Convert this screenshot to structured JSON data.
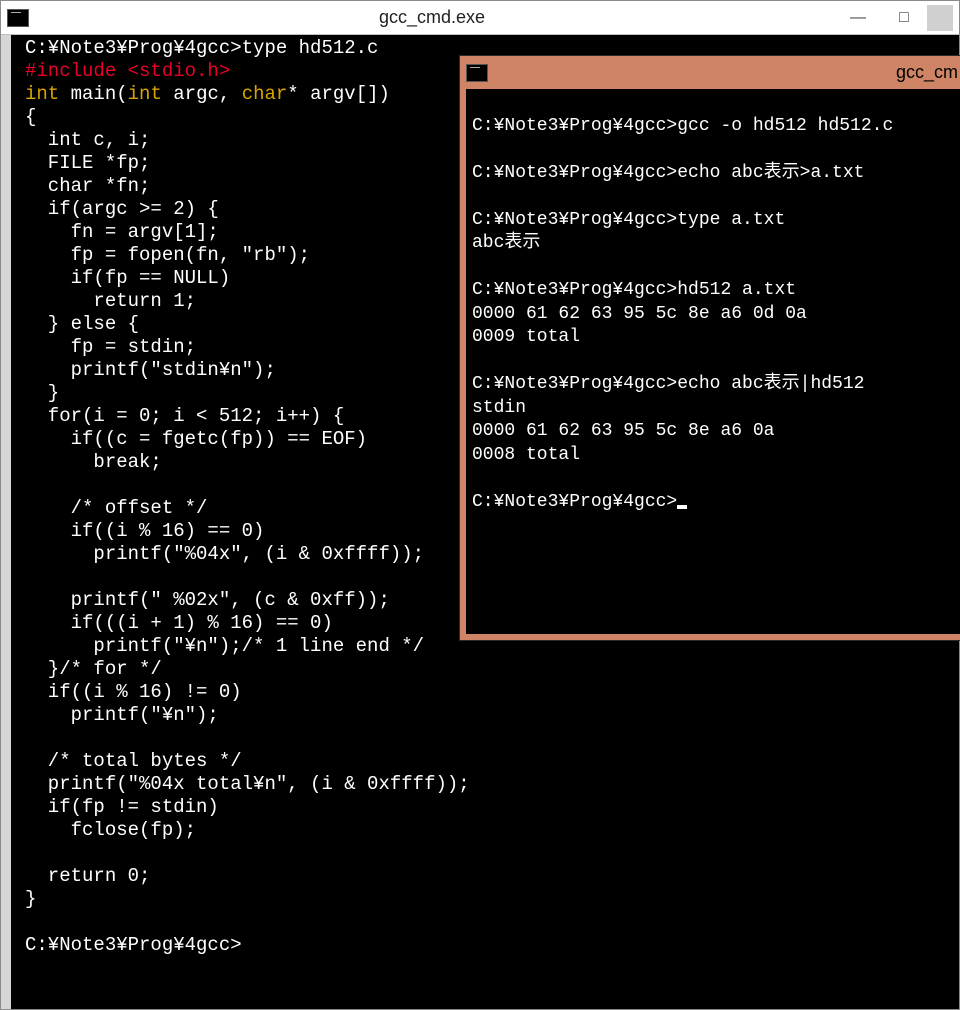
{
  "back_window": {
    "title": "gcc_cmd.exe",
    "min_label": "—",
    "max_label": "□",
    "prompt1": "C:¥Note3¥Prog¥4gcc>",
    "cmd1": "type hd512.c",
    "src_red_include": "#include <stdio.h>",
    "src_proto_a": "int",
    "src_proto_b": " main(",
    "src_proto_c": "int",
    "src_proto_d": " argc, ",
    "src_proto_e": "char",
    "src_proto_f": "* argv[])",
    "src_body": "{\n  int c, i;\n  FILE *fp;\n  char *fn;\n  if(argc >= 2) {\n    fn = argv[1];\n    fp = fopen(fn, \"rb\");\n    if(fp == NULL)\n      return 1;\n  } else {\n    fp = stdin;\n    printf(\"stdin¥n\");\n  }\n  for(i = 0; i < 512; i++) {\n    if((c = fgetc(fp)) == EOF)\n      break;\n\n    /* offset */\n    if((i % 16) == 0)\n      printf(\"%04x\", (i & 0xffff));\n\n    printf(\" %02x\", (c & 0xff));\n    if(((i + 1) % 16) == 0)\n      printf(\"¥n\");/* 1 line end */\n  }/* for */\n  if((i % 16) != 0)\n    printf(\"¥n\");\n\n  /* total bytes */\n  printf(\"%04x total¥n\", (i & 0xffff));\n  if(fp != stdin)\n    fclose(fp);\n\n  return 0;\n}",
    "prompt2": "C:¥Note3¥Prog¥4gcc>"
  },
  "front_window": {
    "title": "gcc_cm",
    "lines": "\nC:¥Note3¥Prog¥4gcc>gcc -o hd512 hd512.c\n\nC:¥Note3¥Prog¥4gcc>echo abc表示>a.txt\n\nC:¥Note3¥Prog¥4gcc>type a.txt\nabc表示\n\nC:¥Note3¥Prog¥4gcc>hd512 a.txt\n0000 61 62 63 95 5c 8e a6 0d 0a\n0009 total\n\nC:¥Note3¥Prog¥4gcc>echo abc表示|hd512\nstdin\n0000 61 62 63 95 5c 8e a6 0a\n0008 total\n",
    "final_prompt": "C:¥Note3¥Prog¥4gcc>"
  }
}
